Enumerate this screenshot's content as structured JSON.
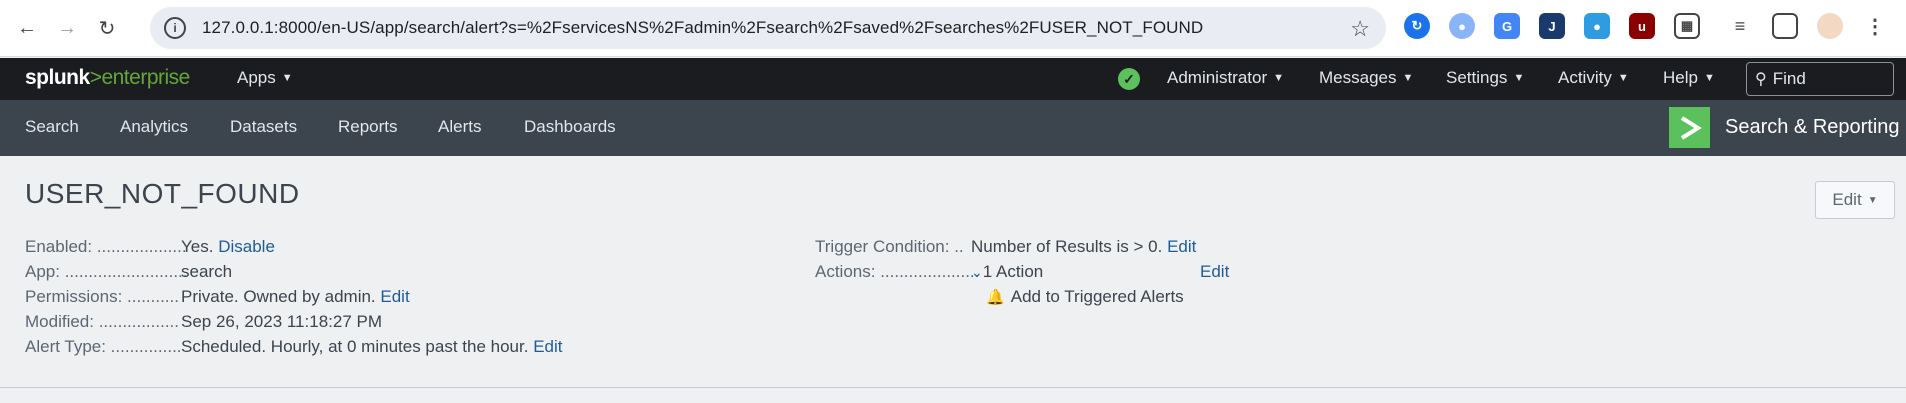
{
  "browser": {
    "url": "127.0.0.1:8000/en-US/app/search/alert?s=%2FservicesNS%2Fadmin%2Fsearch%2Fsaved%2Fsearches%2FUSER_NOT_FOUND"
  },
  "topbar": {
    "logo_main": "splunk",
    "logo_gt": ">",
    "logo_product": "enterprise",
    "apps": "Apps",
    "administrator": "Administrator",
    "messages": "Messages",
    "settings": "Settings",
    "activity": "Activity",
    "help": "Help",
    "find_placeholder": "Find"
  },
  "appnav": {
    "tabs": [
      "Search",
      "Analytics",
      "Datasets",
      "Reports",
      "Alerts",
      "Dashboards"
    ],
    "app_title": "Search & Reporting"
  },
  "alert": {
    "title": "USER_NOT_FOUND",
    "edit_button": "Edit",
    "enabled_label": "Enabled: ...................",
    "enabled_value": "Yes.",
    "enabled_link": "Disable",
    "app_label": "App: ..........................",
    "app_value": "search",
    "permissions_label": "Permissions: ...........",
    "permissions_value": "Private. Owned by admin.",
    "permissions_link": "Edit",
    "modified_label": "Modified: .................",
    "modified_value": "Sep 26, 2023 11:18:27 PM",
    "alert_type_label": "Alert Type: ...............",
    "alert_type_value": "Scheduled. Hourly, at 0 minutes past the hour.",
    "alert_type_link": "Edit",
    "trigger_label": "Trigger Condition: ..",
    "trigger_value": "Number of Results is > 0.",
    "trigger_link": "Edit",
    "actions_label": "Actions: .....................",
    "actions_value": "1 Action",
    "actions_link": "Edit",
    "action_item": "Add to Triggered Alerts"
  },
  "colors": {
    "splunk_green": "#65a637",
    "link_blue": "#1e5c99",
    "topbar_bg": "#1a1c20",
    "appbar_bg": "#3c444d"
  }
}
